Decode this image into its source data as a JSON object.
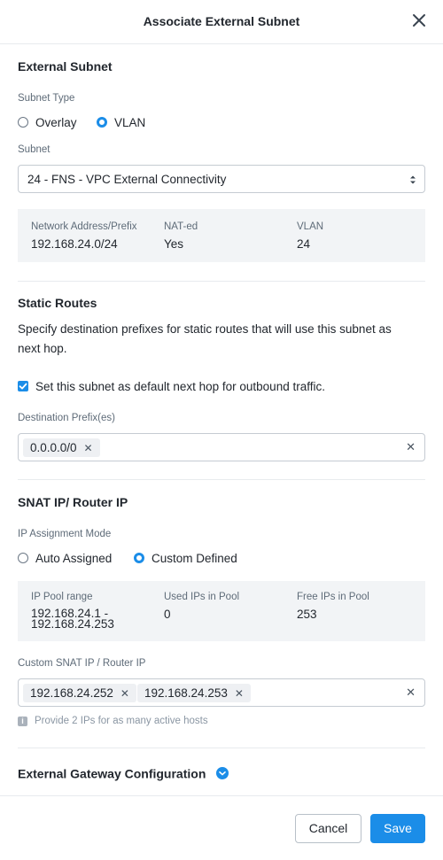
{
  "dialog": {
    "title": "Associate External Subnet"
  },
  "external_subnet": {
    "title": "External Subnet",
    "subnet_type_label": "Subnet Type",
    "options": [
      "Overlay",
      "VLAN"
    ],
    "selected": "VLAN",
    "subnet_label": "Subnet",
    "subnet_value": "24 - FNS - VPC External Connectivity",
    "info": {
      "network_label": "Network Address/Prefix",
      "network_value": "192.168.24.0/24",
      "nat_label": "NAT-ed",
      "nat_value": "Yes",
      "vlan_label": "VLAN",
      "vlan_value": "24"
    }
  },
  "static_routes": {
    "title": "Static Routes",
    "description_line1": "Specify destination prefixes for static routes that will use this subnet as",
    "description_line2": "next hop.",
    "default_checkbox_label": "Set this subnet as default next hop for outbound traffic.",
    "default_checked": true,
    "prefix_label": "Destination Prefix(es)",
    "prefixes": [
      "0.0.0.0/0"
    ]
  },
  "snat": {
    "title": "SNAT IP/ Router IP",
    "mode_label": "IP Assignment Mode",
    "options": [
      "Auto Assigned",
      "Custom Defined"
    ],
    "selected": "Custom Defined",
    "pool": {
      "range_label": "IP Pool range",
      "range_line1": "192.168.24.1 -",
      "range_line2": "192.168.24.253",
      "used_label": "Used IPs in Pool",
      "used_value": "0",
      "free_label": "Free IPs in Pool",
      "free_value": "253"
    },
    "custom_label": "Custom SNAT IP / Router IP",
    "custom_ips": [
      "192.168.24.252",
      "192.168.24.253"
    ],
    "hint": "Provide 2 IPs for as many active hosts"
  },
  "gateway": {
    "title": "External Gateway Configuration"
  },
  "footer": {
    "cancel_label": "Cancel",
    "save_label": "Save"
  },
  "colors": {
    "accent": "#1b8de8",
    "text": "#22272e",
    "muted": "#5e6b78",
    "panel": "#f2f4f6",
    "border": "#c5cbd2"
  },
  "icons": {
    "close": "close-icon",
    "select_arrows": "chevron-up-down-icon",
    "check": "checkmark-icon",
    "remove_tag": "remove-tag-icon",
    "clear": "clear-icon",
    "info": "info-icon",
    "expand": "chevron-down-icon"
  }
}
